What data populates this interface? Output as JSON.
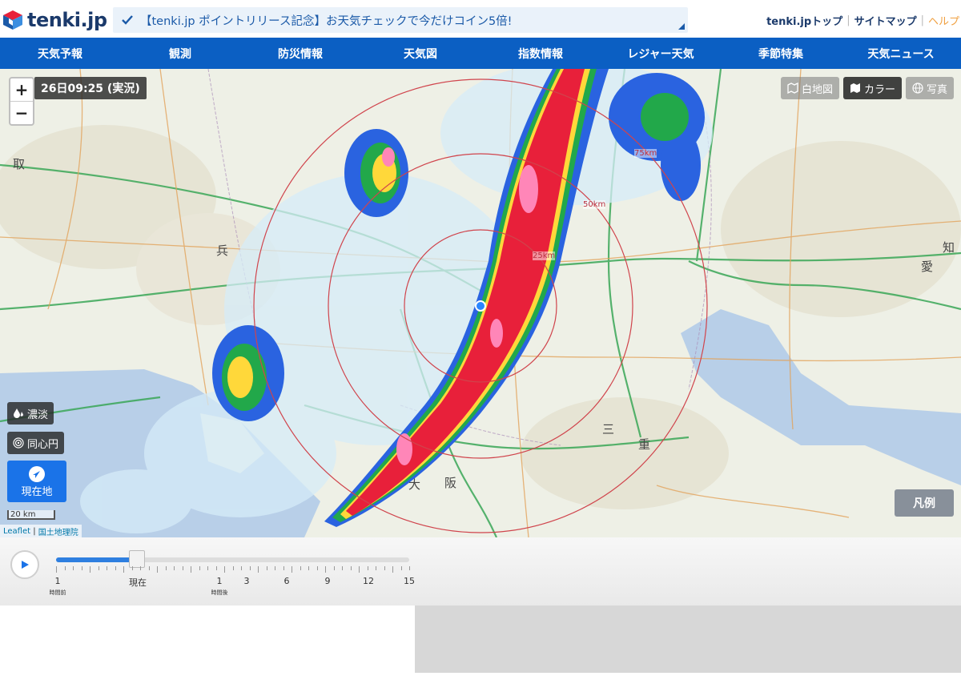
{
  "header": {
    "logo_text": "tenki.jp",
    "banner_text": "【tenki.jp ポイントリリース記念】お天気チェックで今だけコイン5倍!",
    "links": [
      {
        "label": "tenki.jpトップ"
      },
      {
        "label": "サイトマップ"
      },
      {
        "label": "ヘルプ"
      }
    ]
  },
  "nav": {
    "items": [
      "天気予報",
      "観測",
      "防災情報",
      "天気図",
      "指数情報",
      "レジャー天気",
      "季節特集",
      "天気ニュース"
    ]
  },
  "map": {
    "zoom_in": "+",
    "zoom_out": "−",
    "timestamp": "26日09:25 (実況)",
    "layers": {
      "white_map": "白地図",
      "color": "カラー",
      "photo": "写真"
    },
    "opacity_button": "濃淡",
    "circles_button": "同心円",
    "locate_button": "現在地",
    "legend_button": "凡例",
    "scale_label": "20 km",
    "attribution": {
      "leaflet": "Leaflet",
      "sep": " | ",
      "gsi": "国土地理院"
    },
    "ring_labels": [
      "25km",
      "50km",
      "75km"
    ],
    "place_labels": [
      "取",
      "兵",
      "三",
      "重",
      "大",
      "阪",
      "愛",
      "知"
    ]
  },
  "timeline": {
    "current_position_fraction": 0.23,
    "labels": [
      {
        "text": "1",
        "sub": "時間前"
      },
      {
        "text": "現在",
        "sub": ""
      },
      {
        "text": "1",
        "sub": "時間後"
      },
      {
        "text": "3",
        "sub": ""
      },
      {
        "text": "6",
        "sub": ""
      },
      {
        "text": "9",
        "sub": ""
      },
      {
        "text": "12",
        "sub": ""
      },
      {
        "text": "15",
        "sub": ""
      }
    ]
  },
  "colors": {
    "brand_blue": "#0b5fc3",
    "rain_red": "#e8203a",
    "rain_pink": "#ff7fb0",
    "rain_yellow": "#ffe040",
    "rain_green": "#1ea34a",
    "rain_blue": "#2060e0",
    "rain_light": "#bfe3f7"
  }
}
